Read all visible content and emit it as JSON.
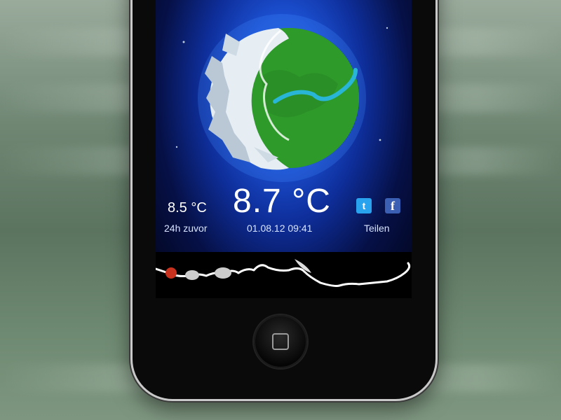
{
  "weather": {
    "previous_temp": "8.5 °C",
    "previous_label": "24h zuvor",
    "current_temp": "8.7 °C",
    "timestamp": "01.08.12 09:41",
    "share_label": "Teilen"
  },
  "icons": {
    "twitter": "twitter-icon",
    "facebook": "facebook-icon",
    "home": "home-button-icon"
  },
  "colors": {
    "screen_blue": "#1b4fd0",
    "globe_green": "#2e9a2a",
    "ice": "#e6eef4",
    "river": "#29b6d6",
    "marker_red": "#c8311e"
  }
}
